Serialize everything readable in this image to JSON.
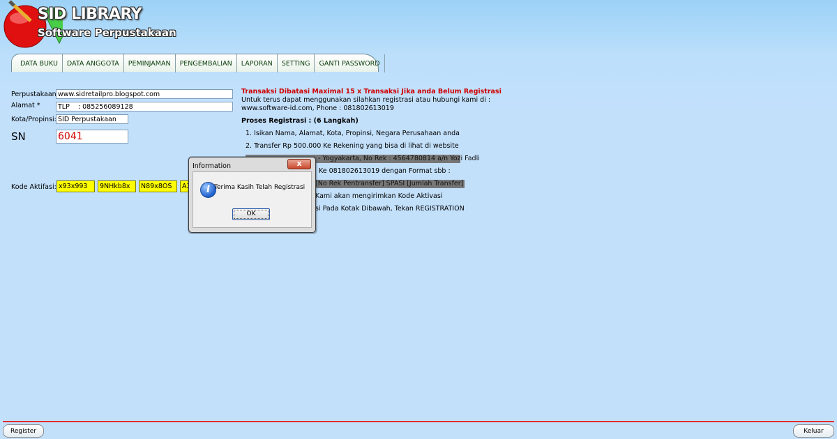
{
  "app": {
    "logo_title": "SID LIBRARY",
    "logo_subtitle": "Software Perpustakaan"
  },
  "tabs": [
    "DATA BUKU",
    "DATA ANGGOTA",
    "PEMINJAMAN",
    "PENGEMBALIAN",
    "LAPORAN",
    "SETTING",
    "GANTI PASSWORD"
  ],
  "form": {
    "perpustakaan_label": "Perpustakaan*",
    "perpustakaan_value": "www.sidretailpro.blogspot.com",
    "alamat_label": "Alamat *",
    "alamat_value": "TLP    : 085256089128",
    "kota_label": "Kota/Propinsi:",
    "kota_value": "SID Perpustakaan",
    "sn_label": "SN",
    "sn_value": "6041",
    "kode_label": "Kode Aktifasi:",
    "kode_values": [
      "x93x993",
      "9NHkb8x",
      "N89x8OS",
      "A3"
    ]
  },
  "info": {
    "warning": "Transaksi Dibatasi Maximal 15 x Transaksi Jika anda Belum Registrasi",
    "line1": "Untuk terus dapat menggunakan silahkan registrasi atau hubungi kami di :",
    "line2": "www.software-id.com, Phone : 081802613019",
    "heading": "Proses Registrasi : (6 Langkah)",
    "step1": "1. Isikan Nama, Alamat, Kota, Propinsi, Negara Perusahaan anda",
    "step2": "2. Transfer Rp 500.000 Ke Rekening yang bisa di lihat di website",
    "step3_visible": "- Yogyakarta, No Rek : 4564780814 a/n Yozi Fadli",
    "step4_visible": "Ke 081802613019 dengan Format sbb :",
    "step5_visible": "[No Rek Pentransfer] SPASI [Jumlah Transfer]",
    "step6_visible": "Kami akan mengirimkan Kode Aktivasi",
    "step7_visible": "si Pada Kotak Dibawah, Tekan REGISTRATION"
  },
  "dialog": {
    "title": "Information",
    "close_label": "x",
    "message": "Terima Kasih Telah Registrasi",
    "ok_label": "OK"
  },
  "footer": {
    "register_label": "Register",
    "keluar_label": "Keluar"
  },
  "colors": {
    "warning": "#d00000",
    "key_highlight": "#ffff00",
    "background": "#c3e0fb"
  }
}
